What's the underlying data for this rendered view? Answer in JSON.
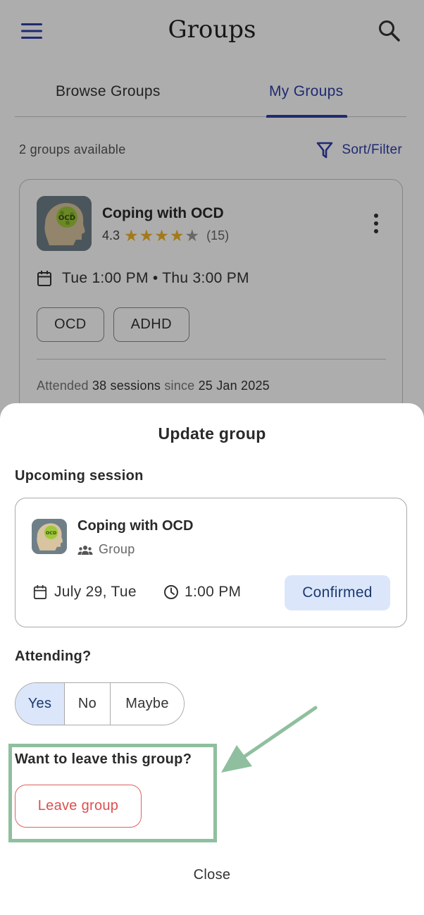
{
  "header": {
    "title": "Groups",
    "menu_icon": "hamburger-menu-icon",
    "search_icon": "search-icon"
  },
  "tabs": [
    {
      "label": "Browse Groups",
      "active": false
    },
    {
      "label": "My Groups",
      "active": true
    }
  ],
  "listing": {
    "count_text": "2 groups available",
    "sort_filter_label": "Sort/Filter"
  },
  "group_card": {
    "name": "Coping with OCD",
    "avatar_text": "OCD",
    "rating": "4.3",
    "stars_filled": 4,
    "stars_total": 5,
    "rating_count": "(15)",
    "schedule": "Tue 1:00 PM • Thu 3:00 PM",
    "tags": [
      "OCD",
      "ADHD"
    ],
    "attended_prefix": "Attended",
    "attended_sessions": "38 sessions",
    "attended_since": "since",
    "attended_date": "25 Jan 2025"
  },
  "sheet": {
    "title": "Update group",
    "upcoming_label": "Upcoming session",
    "session": {
      "name": "Coping with OCD",
      "type": "Group",
      "date": "July 29, Tue",
      "time": "1:00 PM",
      "status": "Confirmed"
    },
    "attending_label": "Attending?",
    "attending_options": [
      "Yes",
      "No",
      "Maybe"
    ],
    "attending_selected": "Yes",
    "leave_question": "Want to leave this group?",
    "leave_button": "Leave group",
    "close_button": "Close"
  },
  "colors": {
    "accent": "#2f3fa8",
    "star": "#f0b429",
    "selected_bg": "#dbe6fb",
    "danger": "#dc4f4f",
    "annotation": "#8fbf9f"
  }
}
